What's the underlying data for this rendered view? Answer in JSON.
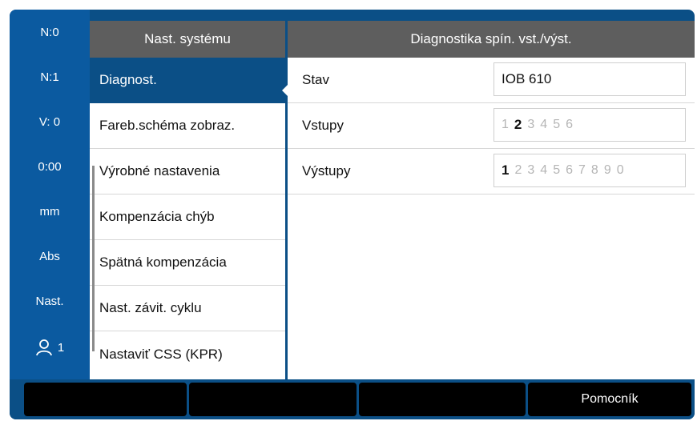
{
  "status_bar": {
    "items": [
      "N:0",
      "N:1",
      "V:  0",
      "0:00",
      "mm",
      "Abs",
      "Nast."
    ],
    "user_count": "1"
  },
  "header": {
    "left_title": "Nast. systému",
    "right_title": "Diagnostika spín. vst./výst."
  },
  "menu": {
    "items": [
      {
        "label": "Diagnost.",
        "selected": true
      },
      {
        "label": "Fareb.schéma zobraz."
      },
      {
        "label": "Výrobné nastavenia"
      },
      {
        "label": "Kompenzácia chýb"
      },
      {
        "label": "Spätná kompenzácia"
      },
      {
        "label": "Nast. závit. cyklu"
      },
      {
        "label": "Nastaviť CSS (KPR)"
      }
    ]
  },
  "diagnostics": {
    "stav_label": "Stav",
    "stav_value": "IOB 610",
    "inputs_label": "Vstupy",
    "inputs": [
      "1",
      "2",
      "3",
      "4",
      "5",
      "6"
    ],
    "inputs_active": [
      false,
      true,
      false,
      false,
      false,
      false
    ],
    "outputs_label": "Výstupy",
    "outputs": [
      "1",
      "2",
      "3",
      "4",
      "5",
      "6",
      "7",
      "8",
      "9",
      "0"
    ],
    "outputs_active": [
      true,
      false,
      false,
      false,
      false,
      false,
      false,
      false,
      false,
      false
    ]
  },
  "softkeys": [
    "",
    "",
    "",
    "Pomocník"
  ],
  "colors": {
    "frame": "#0b4f86",
    "status_bar": "#0b5aa0",
    "header": "#5e5e5e",
    "selected": "#0b4f86"
  }
}
